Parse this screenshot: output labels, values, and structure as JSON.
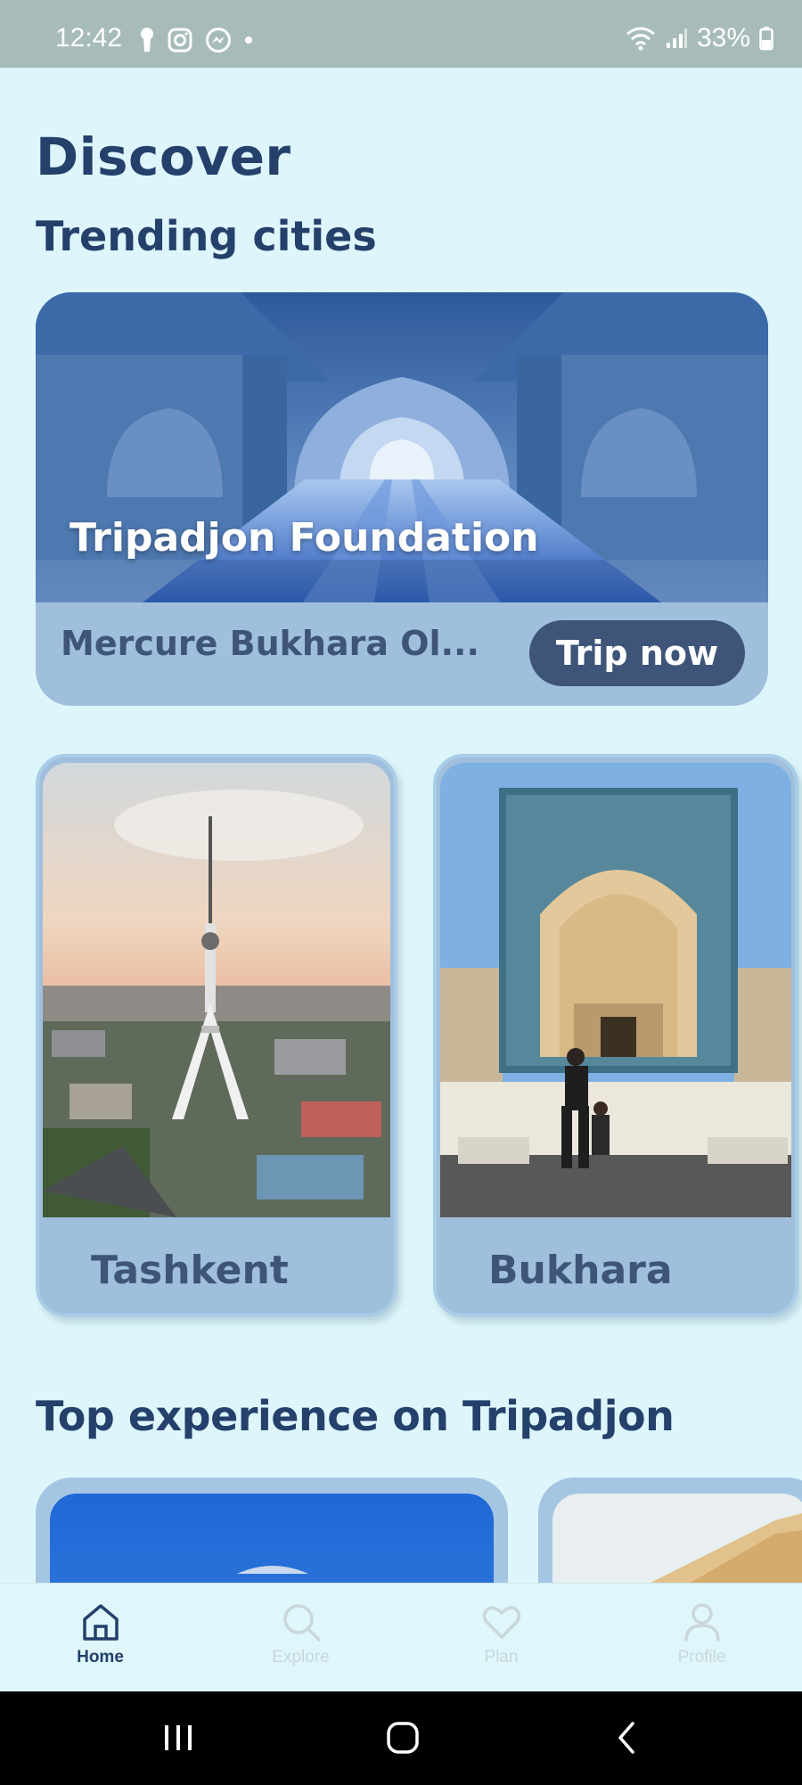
{
  "status_bar": {
    "time": "12:42",
    "battery": "33%"
  },
  "page": {
    "title": "Discover",
    "trending_heading": "Trending cities",
    "experience_heading": "Top experience on Tripadjon"
  },
  "featured": {
    "photo_title": "Tripadjon Foundation",
    "subtitle": "Mercure Bukhara Ol...",
    "button_label": "Trip now"
  },
  "cities": [
    {
      "name": "Tashkent"
    },
    {
      "name": "Bukhara"
    }
  ],
  "bottom_nav": {
    "items": [
      {
        "label": "Home",
        "icon": "home-icon",
        "active": true
      },
      {
        "label": "Explore",
        "icon": "search-icon",
        "active": false
      },
      {
        "label": "Plan",
        "icon": "heart-icon",
        "active": false
      },
      {
        "label": "Profile",
        "icon": "user-icon",
        "active": false
      }
    ]
  },
  "colors": {
    "background": "#def6fb",
    "heading": "#24406b",
    "card": "#9fbfdc",
    "button": "#3e5479",
    "status_bar": "#a7bcb9"
  }
}
